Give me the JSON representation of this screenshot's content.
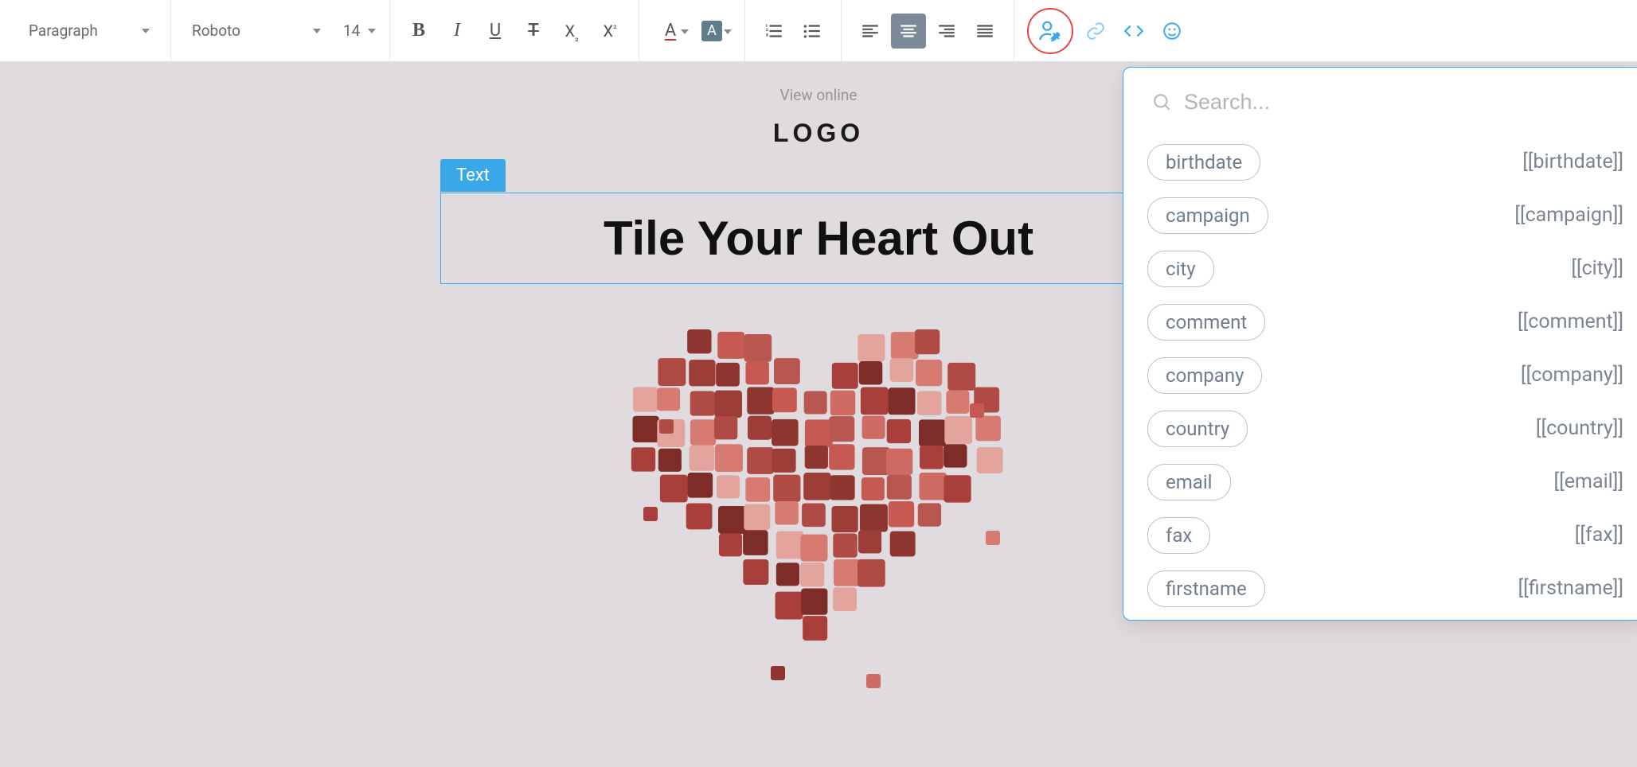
{
  "toolbar": {
    "paragraph": "Paragraph",
    "font": "Roboto",
    "size": "14"
  },
  "canvas": {
    "view_online": "View online",
    "logo": "LOGO",
    "text_tag": "Text",
    "headline": "Tile Your Heart Out"
  },
  "popover": {
    "search_placeholder": "Search...",
    "items": [
      {
        "label": "birthdate",
        "token": "[[birthdate]]"
      },
      {
        "label": "campaign",
        "token": "[[campaign]]"
      },
      {
        "label": "city",
        "token": "[[city]]"
      },
      {
        "label": "comment",
        "token": "[[comment]]"
      },
      {
        "label": "company",
        "token": "[[company]]"
      },
      {
        "label": "country",
        "token": "[[country]]"
      },
      {
        "label": "email",
        "token": "[[email]]"
      },
      {
        "label": "fax",
        "token": "[[fax]]"
      },
      {
        "label": "firstname",
        "token": "[[firstname]]"
      }
    ]
  }
}
